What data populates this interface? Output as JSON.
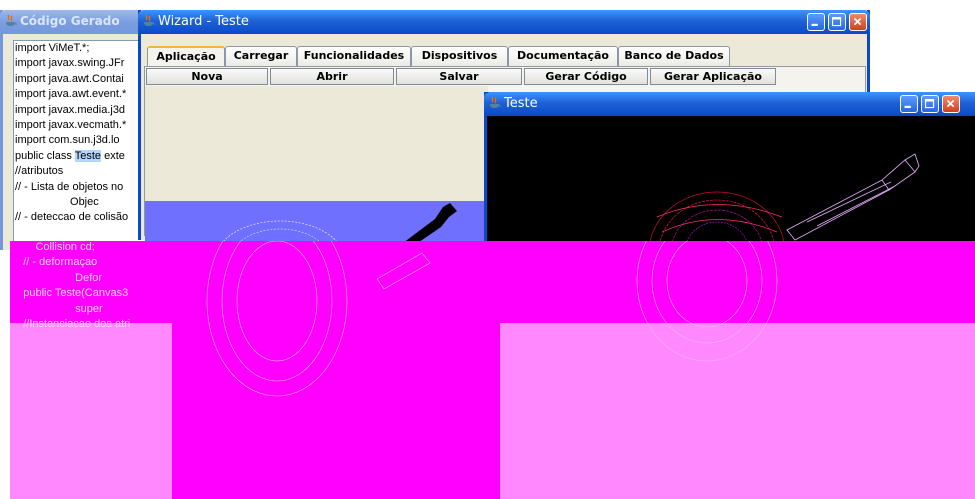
{
  "code_window": {
    "title": "Código Gerado",
    "lines": [
      "import ViMeT.*;",
      "import javax.swing.JFr",
      "import java.awt.Contai",
      "import java.awt.event.*",
      "import javax.media.j3d",
      "import javax.vecmath.*",
      "import com.sun.j3d.lo",
      "public class Teste exte",
      "//atributos",
      "// - Lista de objetos no",
      "                  Objec",
      "// - deteccao de colisão",
      "        Collision cd;",
      "    // - deformaçao",
      "                     Defor",
      "    public Teste(Canvas3",
      "                     super",
      "    //Instanciacao dos atri"
    ],
    "highlight_word": "Teste"
  },
  "wizard_window": {
    "title": "Wizard - Teste",
    "tabs": [
      "Aplicação",
      "Carregar",
      "Funcionalidades",
      "Dispositivos",
      "Documentação",
      "Banco de Dados"
    ],
    "active_tab": "Aplicação",
    "buttons": [
      "Nova",
      "Abrir",
      "Salvar",
      "Gerar Código",
      "Gerar Aplicação"
    ]
  },
  "teste_window": {
    "title": "Teste"
  },
  "colors": {
    "titlebar_active": "#0a49c8",
    "titlebar_inactive": "#7a9ee0",
    "redaction_magenta": "#ff00ff",
    "redaction_pink": "#ff88ff",
    "viewport_blue": "#7070ff",
    "viewport_black": "#000000"
  }
}
